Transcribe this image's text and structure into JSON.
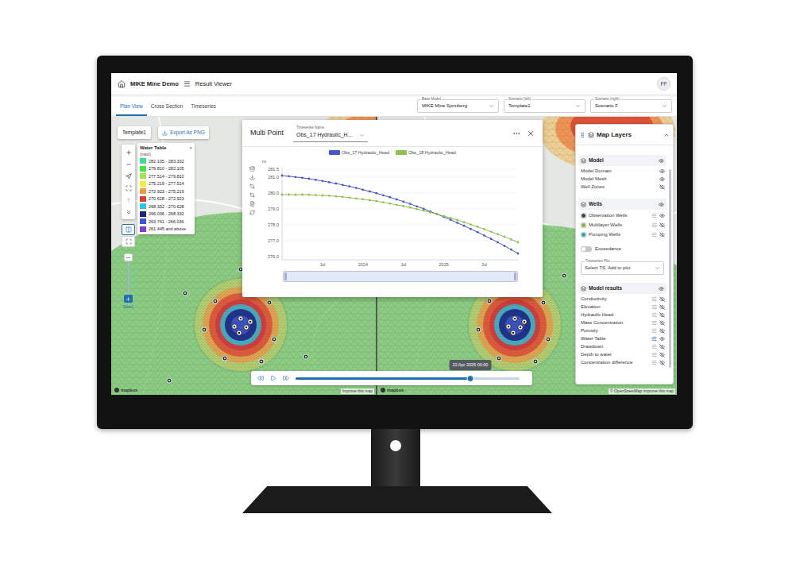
{
  "header": {
    "project": "MIKE Mine Demo",
    "page": "Result Viewer",
    "user": "FF"
  },
  "tabs": [
    {
      "label": "Plan View",
      "selected": true
    },
    {
      "label": "Cross Section",
      "selected": false
    },
    {
      "label": "Timeseries",
      "selected": false
    }
  ],
  "selectors": [
    {
      "label": "Base Model",
      "value": "MIKE Mine Sprinberg"
    },
    {
      "label": "Scenario (left)",
      "value": "Template1"
    },
    {
      "label": "Scenario (right)",
      "value": "Scenario F"
    }
  ],
  "map": {
    "template_button": "Template1",
    "export_button": "Export As PNG",
    "view_modes": [
      {
        "kind": "split",
        "selected": true
      },
      {
        "kind": "single",
        "selected": false
      }
    ],
    "slice_label": "Slice1",
    "legend": {
      "title": "Water Table",
      "close": "×",
      "unit": "(masl)",
      "items": [
        {
          "label": "282.105 - 283.332",
          "color": "#3ddc97"
        },
        {
          "label": "279.810 - 282.105",
          "color": "#3ee83c"
        },
        {
          "label": "277.514 - 279.810",
          "color": "#a6e34f"
        },
        {
          "label": "275.219 - 277.514",
          "color": "#f4ee34"
        },
        {
          "label": "272.923 - 275.219",
          "color": "#f39c3a"
        },
        {
          "label": "270.628 - 272.923",
          "color": "#e03c2e"
        },
        {
          "label": "268.332 - 270.628",
          "color": "#2ec6e8"
        },
        {
          "label": "266.036 - 268.332",
          "color": "#1a237e"
        },
        {
          "label": "263.741 - 266.036",
          "color": "#3b55d9"
        },
        {
          "label": "261.445 and above",
          "color": "#7b3fd6"
        }
      ]
    },
    "left": {
      "logo": "mapbox",
      "attribution": "Improve this map"
    },
    "right": {
      "logo": "mapbox",
      "attribution": "© OpenStreetMap Improve this map"
    }
  },
  "chart": {
    "title": "Multi Point",
    "selector_label": "Timeseries Name",
    "selector_value": "Obs_17 Hydraulic_H...",
    "unit": "m",
    "y_ticks": [
      "281.5",
      "281.0",
      "280.0",
      "279.0",
      "278.0",
      "277.0",
      "276.0"
    ],
    "x_ticks": [
      "Jul",
      "2024",
      "Jul",
      "2025",
      "Jul"
    ],
    "series": [
      {
        "name": "Obs_17 Hydraulic_Head",
        "color": "#4558c9",
        "values": [
          281.1,
          281.06,
          281.01,
          280.96,
          280.9,
          280.83,
          280.76,
          280.68,
          280.6,
          280.51,
          280.42,
          280.32,
          280.21,
          280.1,
          279.99,
          279.86,
          279.74,
          279.6,
          279.46,
          279.32,
          279.16,
          279.01,
          278.84,
          278.67,
          278.5,
          278.32,
          278.13,
          277.94,
          277.74,
          277.54,
          277.33,
          277.12,
          276.9,
          276.67,
          276.44,
          276.2
        ]
      },
      {
        "name": "Obs_18 Hydraulic_Head",
        "color": "#8cc152",
        "values": [
          279.9,
          279.9,
          279.89,
          279.9,
          279.89,
          279.87,
          279.85,
          279.83,
          279.79,
          279.76,
          279.71,
          279.66,
          279.61,
          279.55,
          279.49,
          279.42,
          279.34,
          279.26,
          279.18,
          279.09,
          278.99,
          278.89,
          278.78,
          278.67,
          278.55,
          278.43,
          278.3,
          278.16,
          278.02,
          277.88,
          277.73,
          277.57,
          277.41,
          277.25,
          277.08,
          276.9
        ]
      }
    ]
  },
  "timeline": {
    "level": 0.78,
    "time": "22 Apr 2025 00:00"
  },
  "layers": {
    "title": "Map Layers",
    "sections": [
      {
        "title": "Model",
        "visible": true,
        "items": [
          {
            "label": "Model Domain",
            "kind": "plain",
            "visible": true,
            "active": false
          },
          {
            "label": "Model Mesh",
            "kind": "plain",
            "visible": true,
            "active": false
          },
          {
            "label": "Well Zones",
            "kind": "plain",
            "visible": false,
            "active": false
          }
        ]
      },
      {
        "title": "Wells",
        "visible": true,
        "items": [
          {
            "label": "Observation Wells",
            "kind": "well",
            "visible": true,
            "active": false,
            "color": "#37474f"
          },
          {
            "label": "Multilayer Wells",
            "kind": "well",
            "visible": false,
            "active": false,
            "color": "#7cb342"
          },
          {
            "label": "Pumping Wells",
            "kind": "well",
            "visible": false,
            "active": false,
            "color": "#26a69a"
          }
        ],
        "exceedance": {
          "label": "Exceedance",
          "on": false
        },
        "timeseries_plot": {
          "label": "Timeseries Plot",
          "placeholder": "Select TS, Add to plot"
        }
      },
      {
        "title": "Model results",
        "visible": true,
        "items": [
          {
            "label": "Conductivity",
            "kind": "result",
            "visible": false,
            "active": false
          },
          {
            "label": "Elevation",
            "kind": "result",
            "visible": false,
            "active": false
          },
          {
            "label": "Hydraulic Head",
            "kind": "result",
            "visible": false,
            "active": false
          },
          {
            "label": "Mass Concentration",
            "kind": "result",
            "visible": false,
            "active": false
          },
          {
            "label": "Porosity",
            "kind": "result",
            "visible": false,
            "active": false
          },
          {
            "label": "Water Table",
            "kind": "result",
            "visible": true,
            "active": true
          },
          {
            "label": "Drawdown",
            "kind": "result",
            "visible": false,
            "active": false
          },
          {
            "label": "Depth to water",
            "kind": "result",
            "visible": false,
            "active": false
          },
          {
            "label": "Concentration difference",
            "kind": "result",
            "visible": false,
            "active": false
          }
        ]
      }
    ]
  }
}
